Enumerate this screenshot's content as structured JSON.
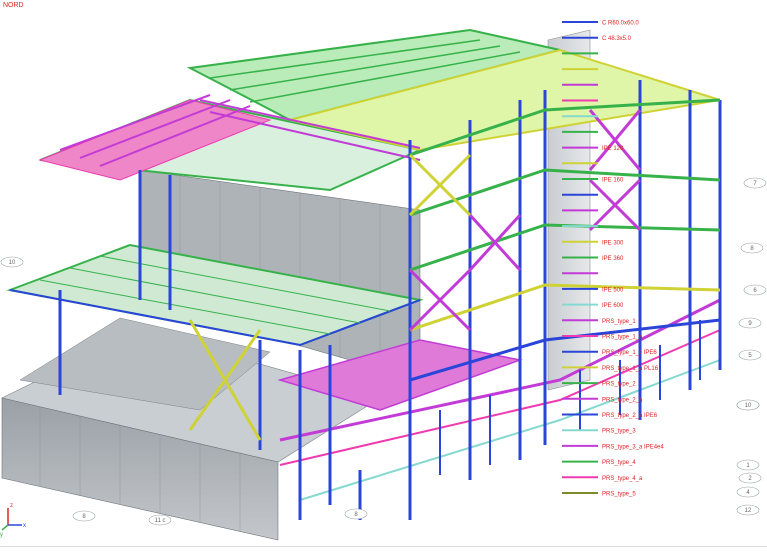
{
  "view": {
    "orientation_label": "NORD"
  },
  "legend": [
    {
      "label": "C R60.0x60.0",
      "color": "#2a45d8"
    },
    {
      "label": "C 48.3x5.0",
      "color": "#2a45d8"
    },
    {
      "label": "",
      "color": "#37b24a"
    },
    {
      "label": "",
      "color": "#cfd234"
    },
    {
      "label": "",
      "color": "#c23bd6"
    },
    {
      "label": "",
      "color": "#ef3bb0"
    },
    {
      "label": "",
      "color": "#86d9d0"
    },
    {
      "label": "",
      "color": "#37b24a"
    },
    {
      "label": "IPE 120",
      "color": "#c23bd6"
    },
    {
      "label": "",
      "color": "#cfd234"
    },
    {
      "label": "IPE 160",
      "color": "#37b24a"
    },
    {
      "label": "",
      "color": "#2a45d8"
    },
    {
      "label": "",
      "color": "#c23bd6"
    },
    {
      "label": "",
      "color": "#86d9d0"
    },
    {
      "label": "IPE 300",
      "color": "#cfd234"
    },
    {
      "label": "IPE 360",
      "color": "#37b24a"
    },
    {
      "label": "",
      "color": "#c23bd6"
    },
    {
      "label": "IPE 500",
      "color": "#2a45d8"
    },
    {
      "label": "IPE 600",
      "color": "#86d9d0"
    },
    {
      "label": "PRS_type_1",
      "color": "#c23bd6"
    },
    {
      "label": "PRS_type_1_a",
      "color": "#ef3bb0"
    },
    {
      "label": "PRS_type_1_c IPE6",
      "color": "#2a45d8"
    },
    {
      "label": "PRS_type_1_a PL16",
      "color": "#cfd234"
    },
    {
      "label": "PRS_type_2",
      "color": "#37b24a"
    },
    {
      "label": "PRS_type_2_a",
      "color": "#c23bd6"
    },
    {
      "label": "PRS_type_2_a IPE6",
      "color": "#2a45d8"
    },
    {
      "label": "PRS_type_3",
      "color": "#86d9d0"
    },
    {
      "label": "PRS_type_3_a IPE4e4",
      "color": "#c23bd6"
    },
    {
      "label": "PRS_type_4",
      "color": "#37b24a"
    },
    {
      "label": "PRS_type_4_a",
      "color": "#ef3bb0"
    },
    {
      "label": "PRS_type_5",
      "color": "#7f8b2a"
    }
  ],
  "grid_bubbles": [
    "10",
    "11",
    "7",
    "8",
    "9",
    "6",
    "5",
    "10",
    "1",
    "2",
    "4",
    "12",
    "8",
    "11 c",
    "8"
  ],
  "axis_triad": {
    "x": "x",
    "y": "y",
    "z": "z"
  }
}
